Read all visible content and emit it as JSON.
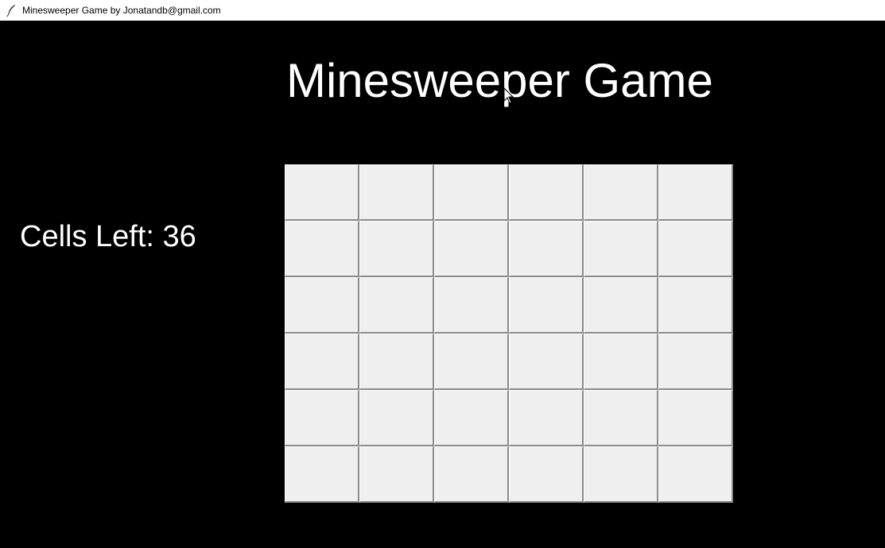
{
  "window": {
    "title": "Minesweeper Game by Jonatandb@gmail.com",
    "icon": "feather-icon"
  },
  "game": {
    "heading": "Minesweeper Game",
    "cells_left_label": "Cells Left: 36",
    "board": {
      "rows": 6,
      "columns": 6,
      "cell_state": "unrevealed",
      "cell_color": "#efefef"
    },
    "background_color": "#000000",
    "text_color": "#ffffff"
  }
}
